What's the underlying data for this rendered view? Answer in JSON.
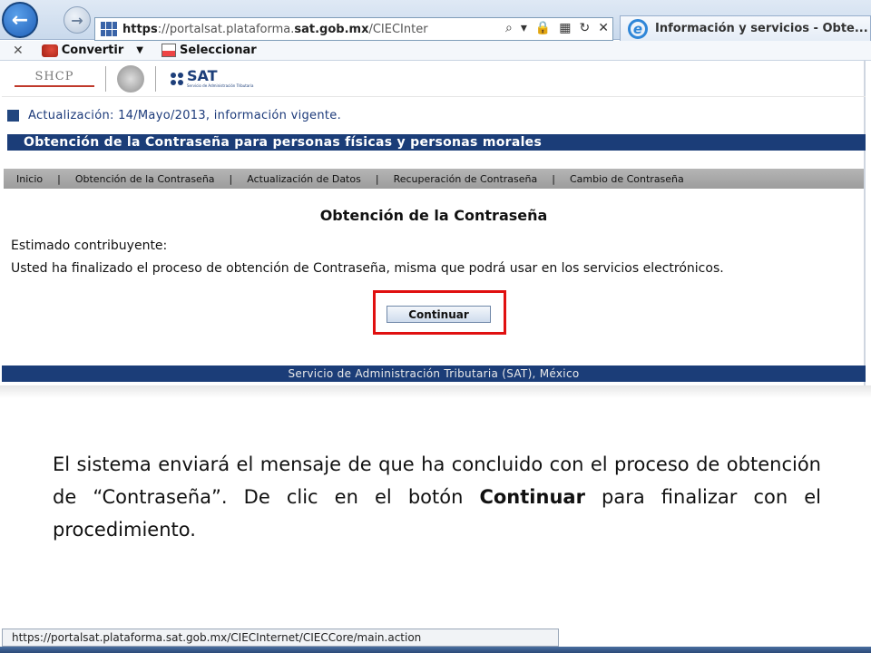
{
  "browser": {
    "address": {
      "scheme": "https",
      "host_prefix": "://portalsat.plataforma.",
      "host_main": "sat.gob.mx",
      "path": "/CIECInter"
    },
    "tab_title": "Información y servicios - Obte...",
    "command_bar": {
      "close": "✕",
      "convert_label": "Convertir",
      "select_label": "Seleccionar"
    },
    "status_url": "https://portalsat.plataforma.sat.gob.mx/CIECInternet/CIECCore/main.action"
  },
  "page": {
    "header": {
      "shcp_label": "SHCP",
      "sat_label": "SAT",
      "sat_subtitle": "Servicio de Administración Tributaria"
    },
    "update_notice": "Actualización: 14/Mayo/2013, información vigente.",
    "section_title": "Obtención de la Contraseña para personas físicas y personas morales",
    "menu": [
      {
        "label": "Inicio"
      },
      {
        "label": "Obtención de la Contraseña"
      },
      {
        "label": "Actualización de Datos"
      },
      {
        "label": "Recuperación de Contraseña"
      },
      {
        "label": "Cambio de Contraseña"
      }
    ],
    "menu_separator": "|",
    "content_title": "Obtención de la Contraseña",
    "greeting": "Estimado contribuyente:",
    "message": "Usted ha finalizado el proceso de obtención de Contraseña, misma que podrá usar en los servicios electrónicos.",
    "continue_button": "Continuar",
    "footer": "Servicio de Administración Tributaria (SAT), México"
  },
  "caption": {
    "part1": "El sistema enviará el mensaje de que ha concluido con el proceso de obtención de “Contraseña”. De clic en el botón ",
    "bold": "Continuar",
    "part2": " para finalizar con el procedimiento."
  },
  "colors": {
    "sat_blue": "#1b3d78",
    "highlight_red": "#e01010",
    "menu_gray": "#a8a8a8"
  }
}
